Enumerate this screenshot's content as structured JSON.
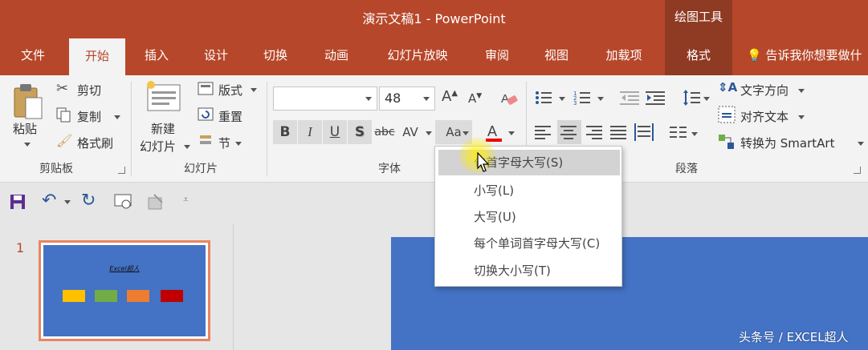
{
  "window": {
    "title": "演示文稿1 - PowerPoint",
    "context_group": "绘图工具"
  },
  "tabs": [
    "文件",
    "开始",
    "插入",
    "设计",
    "切换",
    "动画",
    "幻灯片放映",
    "审阅",
    "视图",
    "加载项",
    "格式"
  ],
  "active_tab": "开始",
  "tell_me": "告诉我你想要做什",
  "clipboard": {
    "paste": "粘贴",
    "cut": "剪切",
    "copy": "复制",
    "format_painter": "格式刷",
    "label": "剪贴板"
  },
  "slides_group": {
    "new_slide_line1": "新建",
    "new_slide_line2": "幻灯片",
    "layout": "版式",
    "reset": "重置",
    "section": "节",
    "label": "幻灯片"
  },
  "font": {
    "font_name": "",
    "font_size": "48",
    "label": "字体"
  },
  "paragraph": {
    "text_direction": "文字方向",
    "align_text": "对齐文本",
    "convert_smartart": "转换为 SmartArt",
    "label": "段落"
  },
  "change_case_menu": {
    "items": [
      "句首字母大写(S)",
      "小写(L)",
      "大写(U)",
      "每个单词首字母大写(C)",
      "切换大小写(T)"
    ],
    "highlighted_index": 0
  },
  "thumbnail": {
    "number": "1",
    "title": "Excel超人",
    "box_colors": [
      "#ffc000",
      "#70ad47",
      "#ed7d31",
      "#c00000"
    ]
  },
  "watermark": "头条号 / EXCEL超人",
  "colors": {
    "accent": "#b7472a",
    "slide_bg": "#4472c4",
    "thumb_border": "#e8855f"
  }
}
